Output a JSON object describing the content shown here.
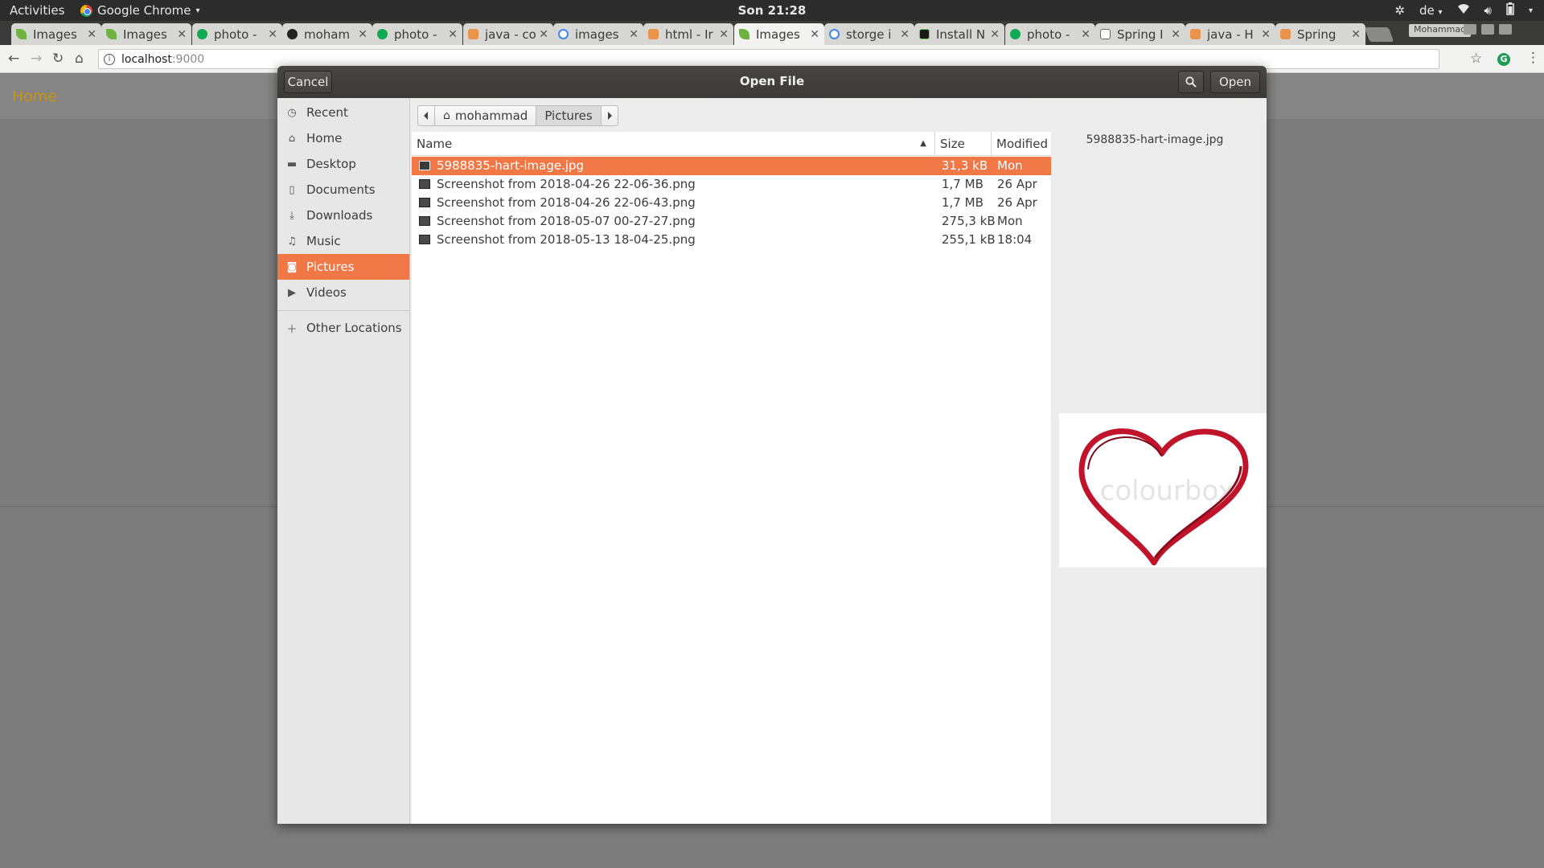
{
  "topbar": {
    "activities": "Activities",
    "app_name": "Google Chrome",
    "clock": "Son 21:28",
    "language": "de"
  },
  "tabs": [
    {
      "title": "Images",
      "favicon": "spring-leaf"
    },
    {
      "title": "Images",
      "favicon": "spring-leaf"
    },
    {
      "title": "photo -",
      "favicon": "green-circle"
    },
    {
      "title": "moham",
      "favicon": "github"
    },
    {
      "title": "photo -",
      "favicon": "green-circle"
    },
    {
      "title": "java - co",
      "favicon": "stackoverflow"
    },
    {
      "title": "images",
      "favicon": "google"
    },
    {
      "title": "html - Ir",
      "favicon": "stackoverflow"
    },
    {
      "title": "Images",
      "favicon": "spring-leaf",
      "active": true
    },
    {
      "title": "storge i",
      "favicon": "google"
    },
    {
      "title": "Install N",
      "favicon": "terminal"
    },
    {
      "title": "photo -",
      "favicon": "green-circle"
    },
    {
      "title": "Spring I",
      "favicon": "page"
    },
    {
      "title": "java - H",
      "favicon": "stackoverflow"
    },
    {
      "title": "Spring",
      "favicon": "stackoverflow"
    }
  ],
  "browser": {
    "profile_name": "Mohammad",
    "url_host": "localhost",
    "url_port": ":9000"
  },
  "page": {
    "home_link": "Home"
  },
  "dialog": {
    "title": "Open File",
    "cancel_label": "Cancel",
    "open_label": "Open",
    "path": [
      {
        "label": "mohammad",
        "icon": "home-icon"
      },
      {
        "label": "Pictures"
      }
    ],
    "sidebar": [
      {
        "label": "Recent",
        "icon": "clock-icon"
      },
      {
        "label": "Home",
        "icon": "home-icon"
      },
      {
        "label": "Desktop",
        "icon": "folder-icon"
      },
      {
        "label": "Documents",
        "icon": "document-icon"
      },
      {
        "label": "Downloads",
        "icon": "download-icon"
      },
      {
        "label": "Music",
        "icon": "music-icon"
      },
      {
        "label": "Pictures",
        "icon": "camera-icon",
        "selected": true
      },
      {
        "label": "Videos",
        "icon": "video-icon"
      }
    ],
    "other_locations": "Other Locations",
    "columns": {
      "name": "Name",
      "size": "Size",
      "modified": "Modified"
    },
    "files": [
      {
        "name": "5988835-hart-image.jpg",
        "size": "31,3 kB",
        "modified": "Mon",
        "selected": true
      },
      {
        "name": "Screenshot from 2018-04-26 22-06-36.png",
        "size": "1,7 MB",
        "modified": "26 Apr"
      },
      {
        "name": "Screenshot from 2018-04-26 22-06-43.png",
        "size": "1,7 MB",
        "modified": "26 Apr"
      },
      {
        "name": "Screenshot from 2018-05-07 00-27-27.png",
        "size": "275,3 kB",
        "modified": "Mon"
      },
      {
        "name": "Screenshot from 2018-05-13 18-04-25.png",
        "size": "255,1 kB",
        "modified": "18:04"
      }
    ],
    "preview": {
      "filename": "5988835-hart-image.jpg",
      "watermark": "colourbox"
    }
  },
  "colors": {
    "accent": "#f07746",
    "link": "#c8930e",
    "heart": "#c0142b"
  }
}
